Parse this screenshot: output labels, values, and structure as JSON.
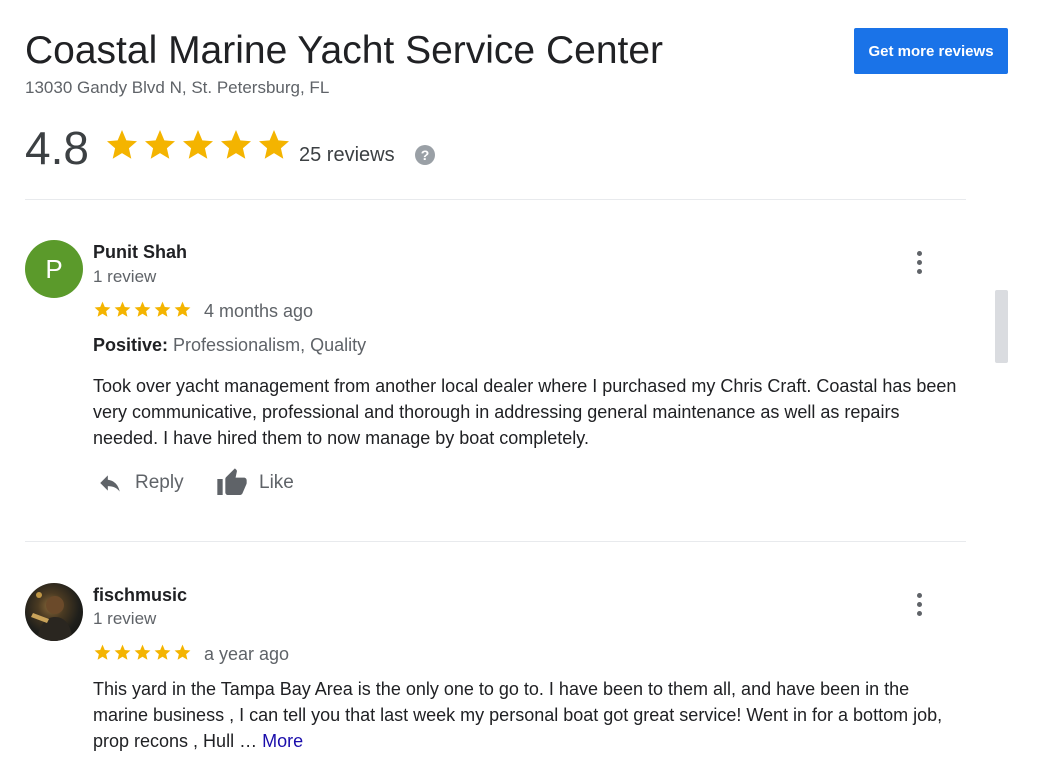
{
  "business": {
    "name": "Coastal Marine Yacht Service Center",
    "address": "13030 Gandy Blvd N, St. Petersburg, FL",
    "rating": "4.8",
    "stars": 5,
    "review_count": "25 reviews",
    "get_more_label": "Get more reviews",
    "help_icon": "?"
  },
  "colors": {
    "star": "#F4B400",
    "accent": "#1A73E8",
    "link": "#1A0DAB"
  },
  "reviews": [
    {
      "avatar_letter": "P",
      "name": "Punit Shah",
      "meta": "1 review",
      "stars": 5,
      "time": "4 months ago",
      "attr_label": "Positive:",
      "attr_value": " Professionalism, Quality",
      "text": "Took over yacht management from another local dealer where I purchased my Chris Craft. Coastal has been very communicative, professional and thorough in addressing general maintenance as well as repairs needed. I have hired them to now manage by boat completely.",
      "reply_label": "Reply",
      "like_label": "Like"
    },
    {
      "avatar": "profile-photo",
      "name": "fischmusic",
      "meta": "1 review",
      "stars": 5,
      "time": "a year ago",
      "text": "This yard in the Tampa Bay Area is the only one to go to.  I have been to them all, and have been in the marine business , I can tell you that last week my personal boat got great service!   Went in for a bottom job, prop recons , Hull … ",
      "more_label": "More"
    }
  ]
}
